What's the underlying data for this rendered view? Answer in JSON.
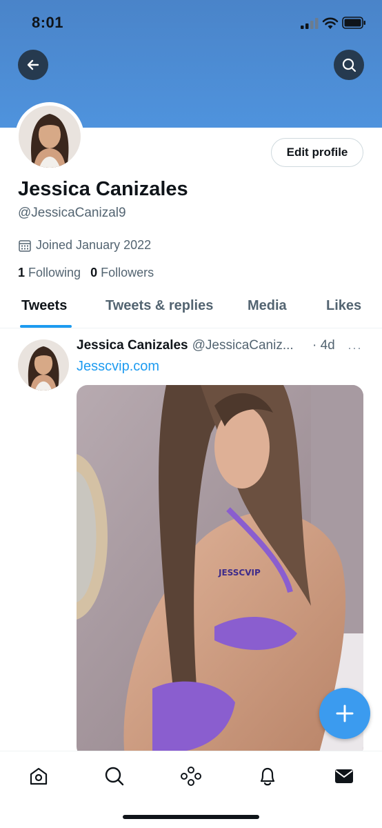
{
  "status_bar": {
    "time": "8:01"
  },
  "header": {
    "back_icon": "arrow-left-icon",
    "search_icon": "search-icon",
    "banner_color": "#4f93dd"
  },
  "profile": {
    "name": "Jessica Canizales",
    "handle": "@JessicaCanizal9",
    "edit_label": "Edit profile",
    "joined": "Joined January 2022",
    "following_count": "1",
    "following_label": "Following",
    "followers_count": "0",
    "followers_label": "Followers"
  },
  "tabs": [
    {
      "label": "Tweets",
      "active": true
    },
    {
      "label": "Tweets & replies",
      "active": false
    },
    {
      "label": "Media",
      "active": false
    },
    {
      "label": "Likes",
      "active": false
    }
  ],
  "tweet": {
    "author": "Jessica Canizales",
    "handle": "@JessicaCaniz...",
    "time": "· 4d",
    "more": "···",
    "link": "Jesscvip.com",
    "watermark": "JESSCVIP"
  },
  "nav": [
    "home-icon",
    "search-icon",
    "spaces-icon",
    "notifications-icon",
    "messages-icon"
  ],
  "colors": {
    "accent": "#1d9bf0",
    "fab": "#3b9bef"
  }
}
